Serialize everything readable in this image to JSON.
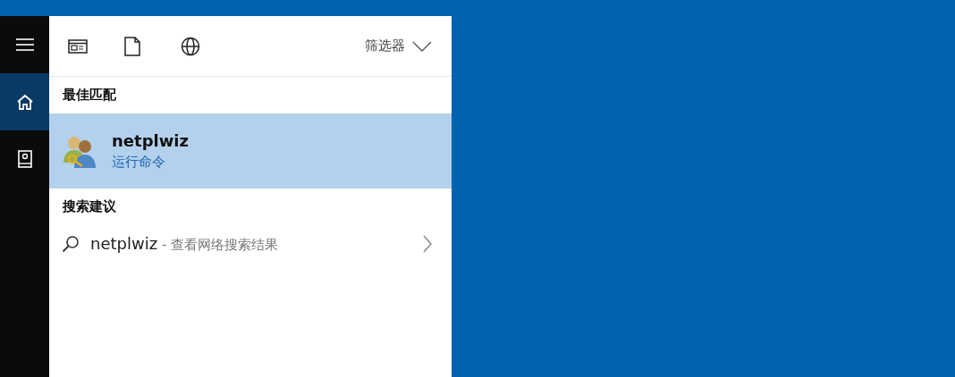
{
  "sidebar": {
    "items": [
      {
        "kind": "menu",
        "selected": false
      },
      {
        "kind": "home",
        "selected": true
      },
      {
        "kind": "notebook",
        "selected": false
      }
    ]
  },
  "toolbar": {
    "scopes": [
      {
        "kind": "apps"
      },
      {
        "kind": "documents"
      },
      {
        "kind": "web"
      }
    ],
    "filter": "筛选器"
  },
  "best_match": {
    "heading": "最佳匹配",
    "title": "netplwiz",
    "subtitle": "运行命令",
    "selected": true
  },
  "suggestions": {
    "heading": "搜索建议",
    "items": [
      {
        "query": "netplwiz",
        "hint": " - 查看网络搜索结果"
      }
    ]
  }
}
